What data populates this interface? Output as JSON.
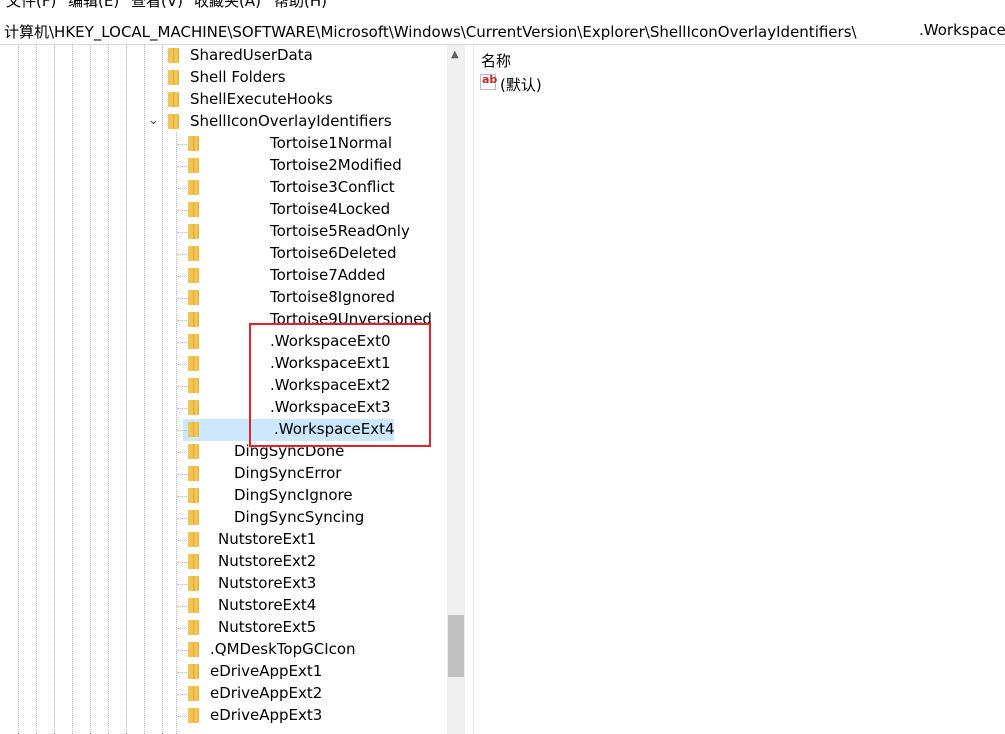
{
  "menu": {
    "file": "文件(F)",
    "edit": "编辑(E)",
    "view": "查看(V)",
    "favorites": "收藏夹(A)",
    "help": "帮助(H)"
  },
  "address": {
    "path": "计算机\\HKEY_LOCAL_MACHINE\\SOFTWARE\\Microsoft\\Windows\\CurrentVersion\\Explorer\\ShellIconOverlayIdentifiers\\",
    "key": ".Workspace"
  },
  "tree": {
    "items": [
      {
        "label": "SharedUserData"
      },
      {
        "label": "Shell Folders"
      },
      {
        "label": "ShellExecuteHooks"
      },
      {
        "label": "ShellIconOverlayIdentifiers"
      },
      {
        "label": "Tortoise1Normal"
      },
      {
        "label": "Tortoise2Modified"
      },
      {
        "label": "Tortoise3Conflict"
      },
      {
        "label": "Tortoise4Locked"
      },
      {
        "label": "Tortoise5ReadOnly"
      },
      {
        "label": "Tortoise6Deleted"
      },
      {
        "label": "Tortoise7Added"
      },
      {
        "label": "Tortoise8Ignored"
      },
      {
        "label": "Tortoise9Unversioned"
      },
      {
        "label": ".WorkspaceExt0"
      },
      {
        "label": ".WorkspaceExt1"
      },
      {
        "label": ".WorkspaceExt2"
      },
      {
        "label": ".WorkspaceExt3"
      },
      {
        "label": ".WorkspaceExt4"
      },
      {
        "label": "DingSyncDone"
      },
      {
        "label": "DingSyncError"
      },
      {
        "label": "DingSyncIgnore"
      },
      {
        "label": "DingSyncSyncing"
      },
      {
        "label": "NutstoreExt1"
      },
      {
        "label": "NutstoreExt2"
      },
      {
        "label": "NutstoreExt3"
      },
      {
        "label": "NutstoreExt4"
      },
      {
        "label": "NutstoreExt5"
      },
      {
        "label": ".QMDeskTopGCIcon"
      },
      {
        "label": "eDriveAppExt1"
      },
      {
        "label": "eDriveAppExt2"
      },
      {
        "label": "eDriveAppExt3"
      }
    ],
    "selected_item": ".WorkspaceExt4"
  },
  "values_pane": {
    "column_name": "名称",
    "rows": [
      {
        "icon": "string-value-icon",
        "name": "(默认)"
      }
    ]
  },
  "colors": {
    "selection": "#cce8ff",
    "highlight_box": "#e0242a"
  }
}
